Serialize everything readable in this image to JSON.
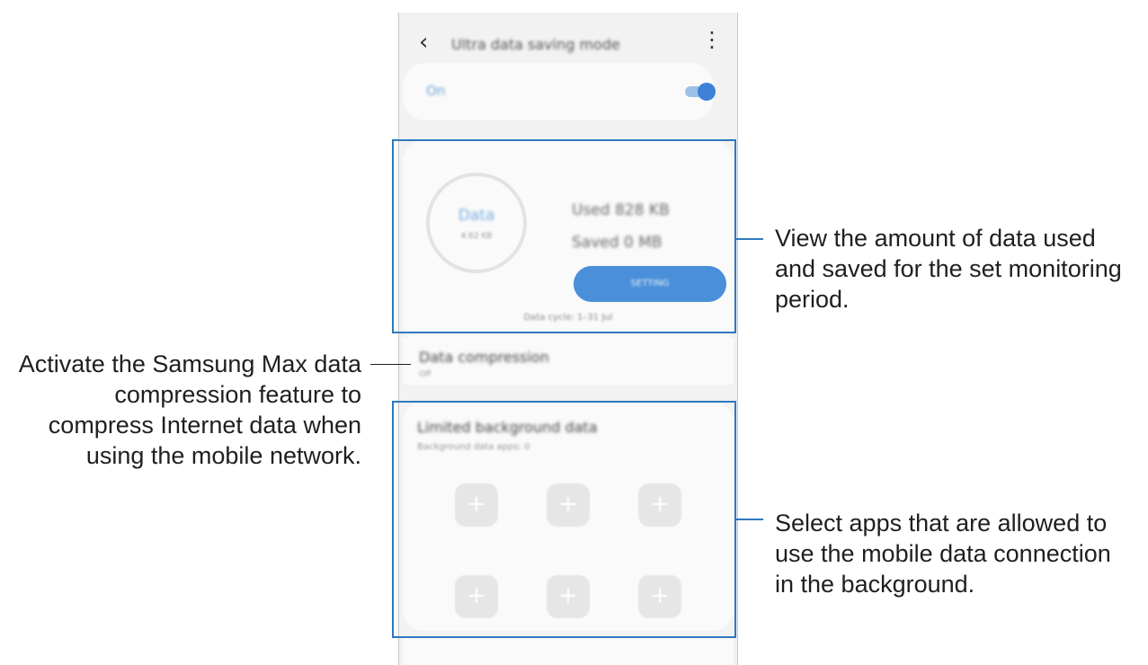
{
  "phone": {
    "back_icon": "chevron-left-icon",
    "title": "Ultra data saving mode",
    "more_icon": "more-vert-icon",
    "toggle_label": "On",
    "stats": {
      "ring_main": "Data",
      "ring_sub": "4.62 KB",
      "used": "Used 828 KB",
      "saved": "Saved 0 MB",
      "button": "SETTING",
      "cycle": "Data cycle: 1–31 Jul"
    },
    "compression": {
      "title": "Data compression",
      "subtitle": "Off"
    },
    "background": {
      "title": "Limited background data",
      "subtitle": "Background data apps: 0",
      "slots": [
        "+",
        "+",
        "+",
        "+",
        "+",
        "+"
      ]
    }
  },
  "callouts": {
    "stats": "View the amount of data used\nand saved for the set monitoring\nperiod.",
    "apps": "Select apps that are allowed to\nuse the mobile data connection\nin the background.",
    "compression": "Activate the Samsung Max data\ncompression feature to\ncompress Internet data when\nusing the mobile network."
  },
  "colors": {
    "accent": "#3d82d6",
    "highlight": "#2f78c0"
  }
}
